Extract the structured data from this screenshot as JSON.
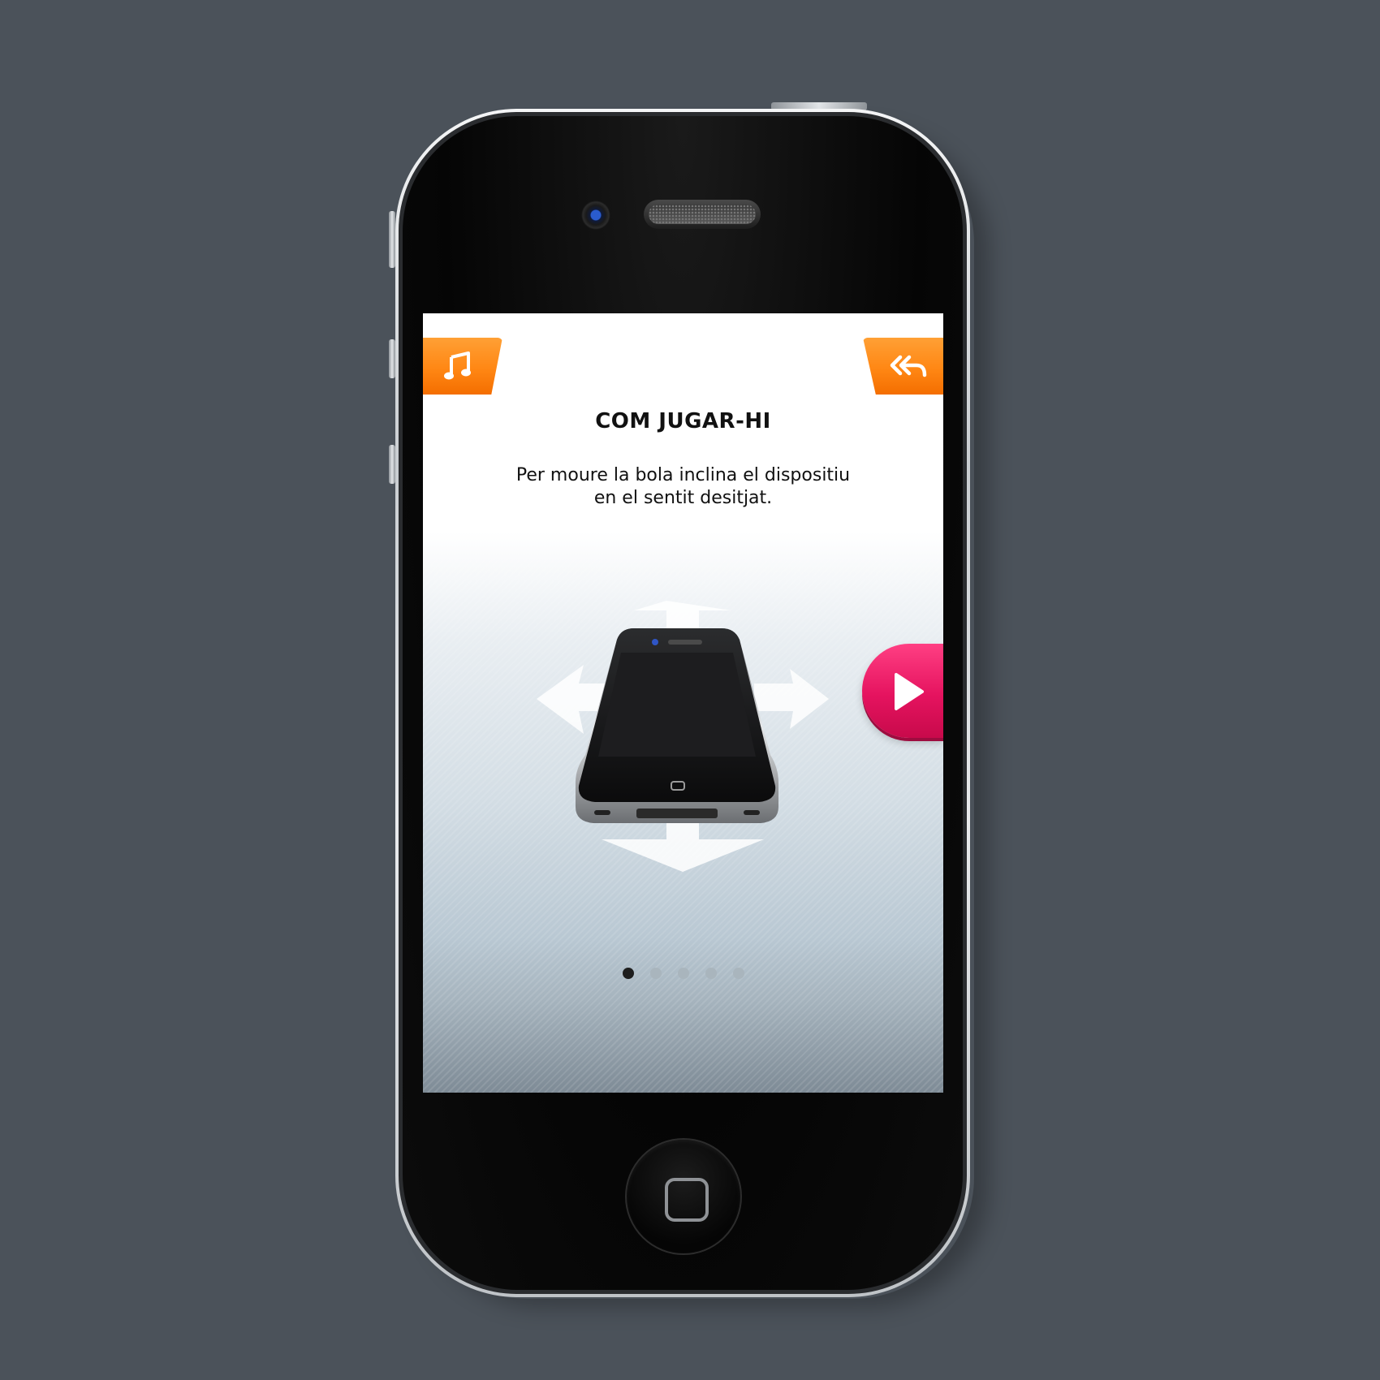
{
  "screen": {
    "title": "COM JUGAR-HI",
    "description_line1": "Per moure la bola inclina el dispositiu",
    "description_line2": "en el sentit desitjat."
  },
  "buttons": {
    "music_icon": "music-note-icon",
    "back_icon": "double-back-arrow-icon",
    "next_icon": "play-arrow-icon"
  },
  "pagination": {
    "total_pages": 5,
    "current_page": 1
  },
  "colors": {
    "accent_orange": "#ff8714",
    "accent_pink": "#e5135f",
    "background": "#4b525a"
  }
}
